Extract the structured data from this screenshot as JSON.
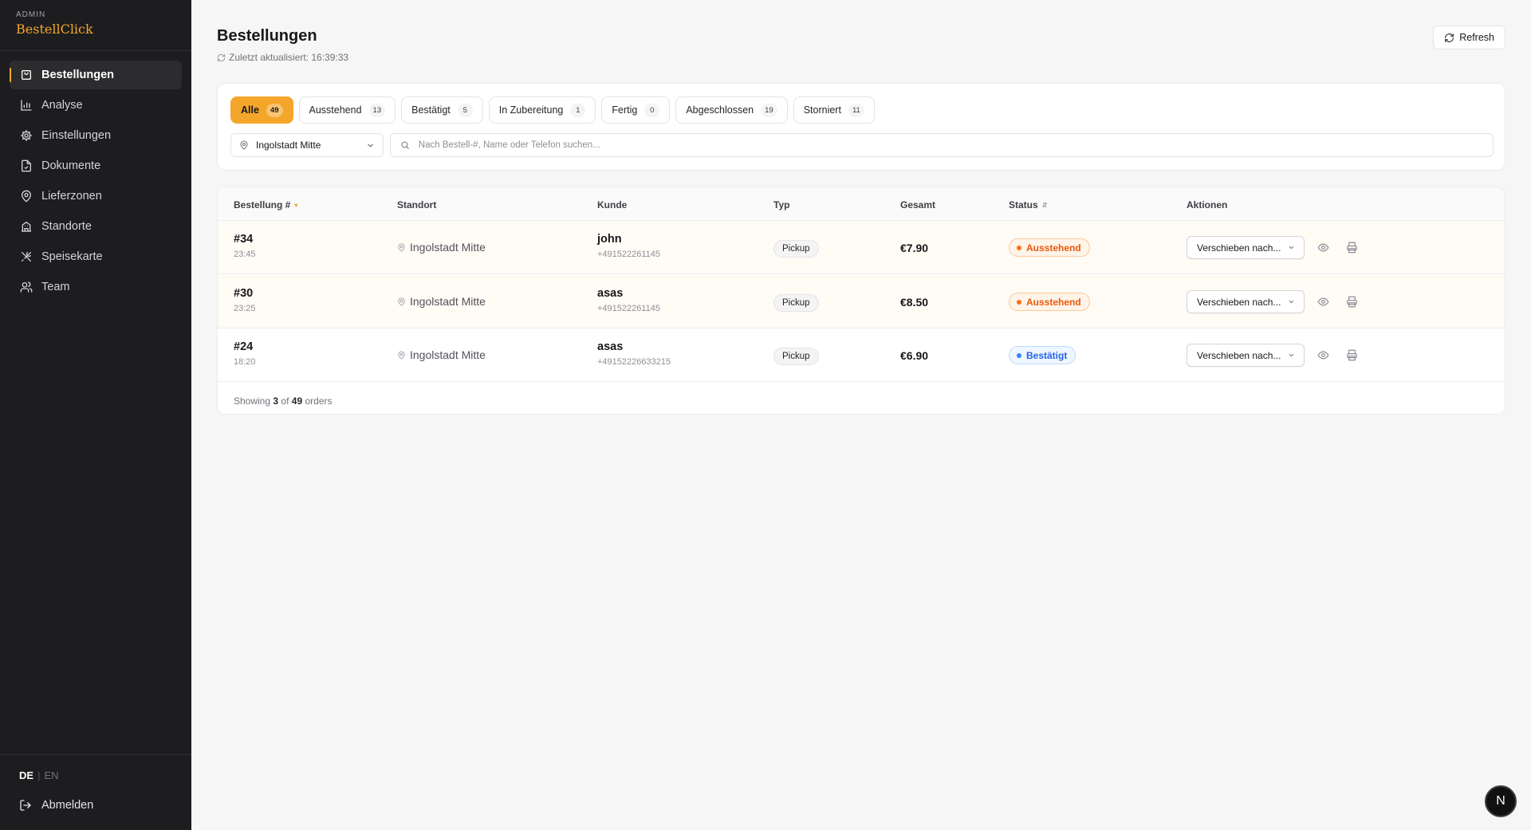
{
  "brand": {
    "kicker": "ADMIN",
    "name": "BestellClick"
  },
  "nav": {
    "items": [
      {
        "label": "Bestellungen",
        "icon": "shopping-bag-icon",
        "active": true
      },
      {
        "label": "Analyse",
        "icon": "bar-chart-icon"
      },
      {
        "label": "Einstellungen",
        "icon": "gear-icon"
      },
      {
        "label": "Dokumente",
        "icon": "document-icon"
      },
      {
        "label": "Lieferzonen",
        "icon": "map-pin-icon"
      },
      {
        "label": "Standorte",
        "icon": "building-icon"
      },
      {
        "label": "Speisekarte",
        "icon": "utensils-icon"
      },
      {
        "label": "Team",
        "icon": "users-icon"
      }
    ]
  },
  "lang": {
    "active": "DE",
    "separator": "|",
    "other": "EN"
  },
  "logout": {
    "label": "Abmelden"
  },
  "header": {
    "title": "Bestellungen",
    "updated": "Zuletzt aktualisiert: 16:39:33",
    "refresh_label": "Refresh"
  },
  "tabs": [
    {
      "label": "Alle",
      "count": "49",
      "active": true
    },
    {
      "label": "Ausstehend",
      "count": "13"
    },
    {
      "label": "Bestätigt",
      "count": "5"
    },
    {
      "label": "In Zubereitung",
      "count": "1"
    },
    {
      "label": "Fertig",
      "count": "0"
    },
    {
      "label": "Abgeschlossen",
      "count": "19"
    },
    {
      "label": "Storniert",
      "count": "11"
    }
  ],
  "filters": {
    "location": "Ingolstadt Mitte",
    "search_placeholder": "Nach Bestell-#, Name oder Telefon suchen..."
  },
  "table": {
    "columns": {
      "order": "Bestellung #",
      "location": "Standort",
      "customer": "Kunde",
      "type": "Typ",
      "total": "Gesamt",
      "status": "Status",
      "actions": "Aktionen"
    },
    "move_label": "Verschieben nach...",
    "rows": [
      {
        "number": "#34",
        "time": "23:45",
        "location": "Ingolstadt Mitte",
        "customer": "john",
        "phone": "+491522261145",
        "type": "Pickup",
        "total": "€7.90",
        "status": "Ausstehend",
        "status_kind": "pending"
      },
      {
        "number": "#30",
        "time": "23:25",
        "location": "Ingolstadt Mitte",
        "customer": "asas",
        "phone": "+491522261145",
        "type": "Pickup",
        "total": "€8.50",
        "status": "Ausstehend",
        "status_kind": "pending"
      },
      {
        "number": "#24",
        "time": "18:20",
        "location": "Ingolstadt Mitte",
        "customer": "asas",
        "phone": "+49152226633215",
        "type": "Pickup",
        "total": "€6.90",
        "status": "Bestätigt",
        "status_kind": "confirmed"
      }
    ],
    "footer": {
      "prefix": "Showing",
      "shown": "3",
      "of": "of",
      "total": "49",
      "suffix": "orders"
    }
  },
  "fab": {
    "label": "N"
  },
  "colors": {
    "accent": "#f4a62a",
    "sidebar": "#1d1d1f",
    "pending": "#ea580c",
    "confirmed": "#2563eb"
  }
}
